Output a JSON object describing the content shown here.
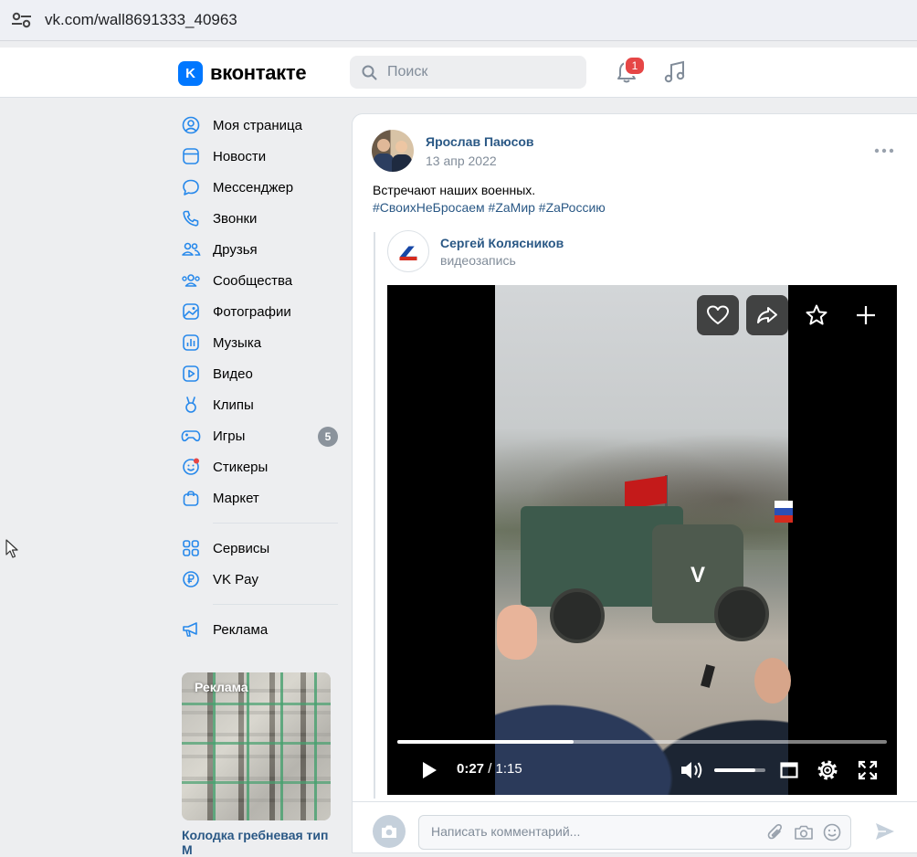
{
  "browser": {
    "url": "vk.com/wall8691333_40963"
  },
  "header": {
    "logo_text": "вконтакте",
    "logo_mark": "K",
    "search_placeholder": "Поиск",
    "notifications_count": "1"
  },
  "sidebar": {
    "items": [
      {
        "label": "Моя страница",
        "icon": "user-circle-icon"
      },
      {
        "label": "Новости",
        "icon": "news-icon"
      },
      {
        "label": "Мессенджер",
        "icon": "message-icon"
      },
      {
        "label": "Звонки",
        "icon": "phone-icon"
      },
      {
        "label": "Друзья",
        "icon": "friends-icon"
      },
      {
        "label": "Сообщества",
        "icon": "communities-icon"
      },
      {
        "label": "Фотографии",
        "icon": "photo-icon"
      },
      {
        "label": "Музыка",
        "icon": "music-icon"
      },
      {
        "label": "Видео",
        "icon": "video-icon"
      },
      {
        "label": "Клипы",
        "icon": "clips-icon"
      },
      {
        "label": "Игры",
        "icon": "gamepad-icon",
        "count": "5"
      },
      {
        "label": "Стикеры",
        "icon": "sticker-icon"
      },
      {
        "label": "Маркет",
        "icon": "market-icon"
      }
    ],
    "extra": [
      {
        "label": "Сервисы",
        "icon": "services-icon"
      },
      {
        "label": "VK Pay",
        "icon": "vkpay-icon"
      }
    ],
    "ads_link": {
      "label": "Реклама",
      "icon": "megaphone-icon"
    },
    "ad": {
      "badge": "Реклама",
      "title": "Колодка гребневая тип М"
    }
  },
  "post": {
    "author": "Ярослав Паюсов",
    "date": "13 апр 2022",
    "text": "Встречают наших военных.",
    "hashtags": "#СвоихНеБросаем #ZaМир #ZaРоссию",
    "repost": {
      "author": "Сергей Колясников",
      "avatar_letter": "Z",
      "type": "видеозапись",
      "video": {
        "current_time": "0:27",
        "duration": " / 1:15",
        "progress": 0.36,
        "volume": 0.8,
        "truck_mark": "V"
      }
    },
    "comment_placeholder": "Написать комментарий..."
  },
  "colors": {
    "accent": "#0077ff",
    "link": "#2a5885",
    "muted": "#818c99",
    "badge_red": "#e64646"
  }
}
